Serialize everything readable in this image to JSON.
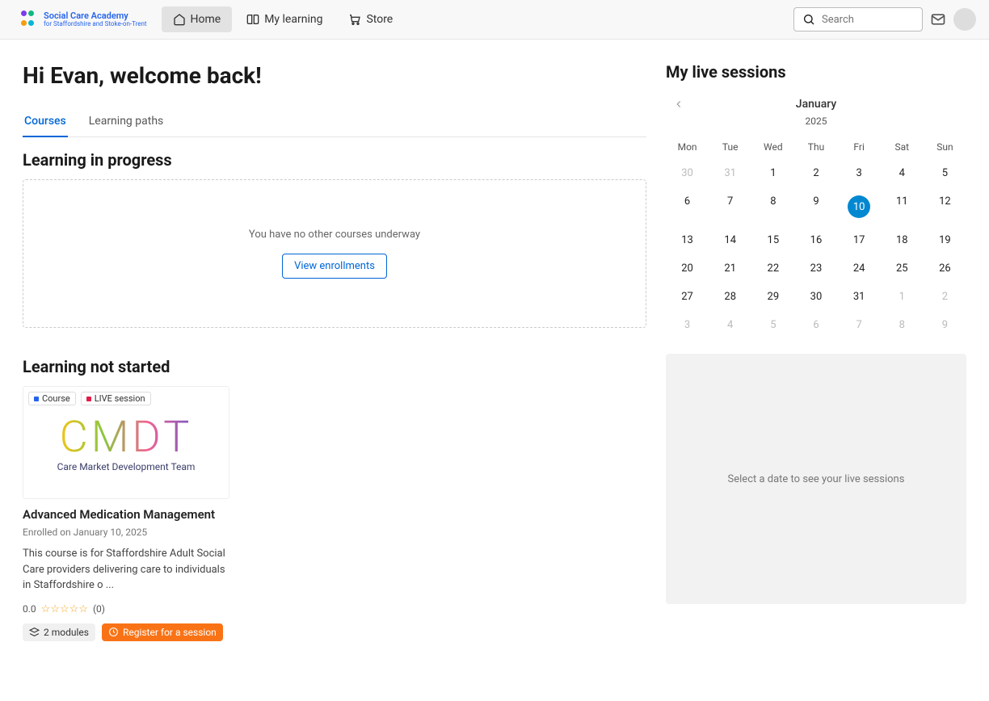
{
  "header": {
    "logo_title": "Social Care Academy",
    "logo_subtitle": "for Staffordshire and Stoke-on-Trent",
    "nav": [
      {
        "label": "Home",
        "active": true
      },
      {
        "label": "My learning",
        "active": false
      },
      {
        "label": "Store",
        "active": false
      }
    ],
    "search_placeholder": "Search"
  },
  "welcome": "Hi Evan, welcome back!",
  "tabs": [
    {
      "label": "Courses",
      "active": true
    },
    {
      "label": "Learning paths",
      "active": false
    }
  ],
  "sections": {
    "in_progress_title": "Learning in progress",
    "in_progress_empty": "You have no other courses underway",
    "view_enrollments_btn": "View enrollments",
    "not_started_title": "Learning not started"
  },
  "course": {
    "badge_course": "Course",
    "badge_live": "LIVE session",
    "cover_abbr": "CMDT",
    "cover_text": "Care Market Development Team",
    "title": "Advanced Medication Management",
    "enrolled": "Enrolled on January 10, 2025",
    "description": "This course is for Staffordshire Adult Social Care providers delivering care to individuals in Staffordshire o ...",
    "rating_value": "0.0",
    "rating_count": "(0)",
    "modules": "2 modules",
    "register": "Register for a session"
  },
  "live_sessions": {
    "title": "My live sessions",
    "month": "January",
    "year": "2025",
    "dows": [
      "Mon",
      "Tue",
      "Wed",
      "Thu",
      "Fri",
      "Sat",
      "Sun"
    ],
    "cells": [
      {
        "d": "30",
        "muted": true
      },
      {
        "d": "31",
        "muted": true
      },
      {
        "d": "1"
      },
      {
        "d": "2"
      },
      {
        "d": "3"
      },
      {
        "d": "4"
      },
      {
        "d": "5"
      },
      {
        "d": "6"
      },
      {
        "d": "7"
      },
      {
        "d": "8"
      },
      {
        "d": "9"
      },
      {
        "d": "10",
        "today": true
      },
      {
        "d": "11"
      },
      {
        "d": "12"
      },
      {
        "d": "13"
      },
      {
        "d": "14"
      },
      {
        "d": "15"
      },
      {
        "d": "16"
      },
      {
        "d": "17"
      },
      {
        "d": "18"
      },
      {
        "d": "19"
      },
      {
        "d": "20"
      },
      {
        "d": "21"
      },
      {
        "d": "22"
      },
      {
        "d": "23"
      },
      {
        "d": "24"
      },
      {
        "d": "25"
      },
      {
        "d": "26"
      },
      {
        "d": "27"
      },
      {
        "d": "28"
      },
      {
        "d": "29"
      },
      {
        "d": "30"
      },
      {
        "d": "31"
      },
      {
        "d": "1",
        "muted": true
      },
      {
        "d": "2",
        "muted": true
      },
      {
        "d": "3",
        "muted": true
      },
      {
        "d": "4",
        "muted": true
      },
      {
        "d": "5",
        "muted": true
      },
      {
        "d": "6",
        "muted": true
      },
      {
        "d": "7",
        "muted": true
      },
      {
        "d": "8",
        "muted": true
      },
      {
        "d": "9",
        "muted": true
      }
    ],
    "empty_msg": "Select a date to see your live sessions"
  }
}
